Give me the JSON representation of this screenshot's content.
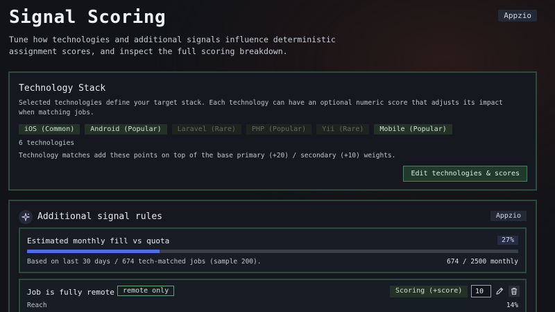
{
  "header": {
    "title": "Signal Scoring",
    "subtitle": "Tune how technologies and additional signals influence deterministic assignment scores, and inspect the full scoring breakdown.",
    "workspace_badge": "Appzio"
  },
  "tech_stack": {
    "title": "Technology Stack",
    "description": "Selected technologies define your target stack. Each technology can have an optional numeric score that adjusts its impact when matching jobs.",
    "chips": [
      {
        "label": "iOS (Common)",
        "active": true
      },
      {
        "label": "Android (Popular)",
        "active": true
      },
      {
        "label": "Laravel (Rare)",
        "active": false
      },
      {
        "label": "PHP (Popular)",
        "active": false
      },
      {
        "label": "Yii (Rare)",
        "active": false
      },
      {
        "label": "Mobile (Popular)",
        "active": true
      }
    ],
    "count_text": "6 technologies",
    "note": "Technology matches add these points on top of the base primary (+20) / secondary (+10) weights.",
    "edit_button_label": "Edit technologies & scores"
  },
  "signals": {
    "title": "Additional signal rules",
    "badge": "Appzio",
    "icon": "sparkle-icon",
    "fill": {
      "title": "Estimated monthly fill vs quota",
      "percent_label": "27%",
      "fraction": 0.27,
      "footnote": "Based on last 30 days / 674 tech-matched jobs (sample 200).",
      "quota_text": "674 / 2500 monthly"
    },
    "rules": [
      {
        "title": "Job is fully remote",
        "tag": "remote only",
        "scoring_mode": "Scoring (+score)",
        "score_value": "10",
        "reach_label": "Reach",
        "reach_value": "14%"
      }
    ]
  },
  "colors": {
    "accent_green": "#3d8a5a",
    "progress_blue": "#4f6ee8",
    "card_border": "#2f4a3c"
  }
}
